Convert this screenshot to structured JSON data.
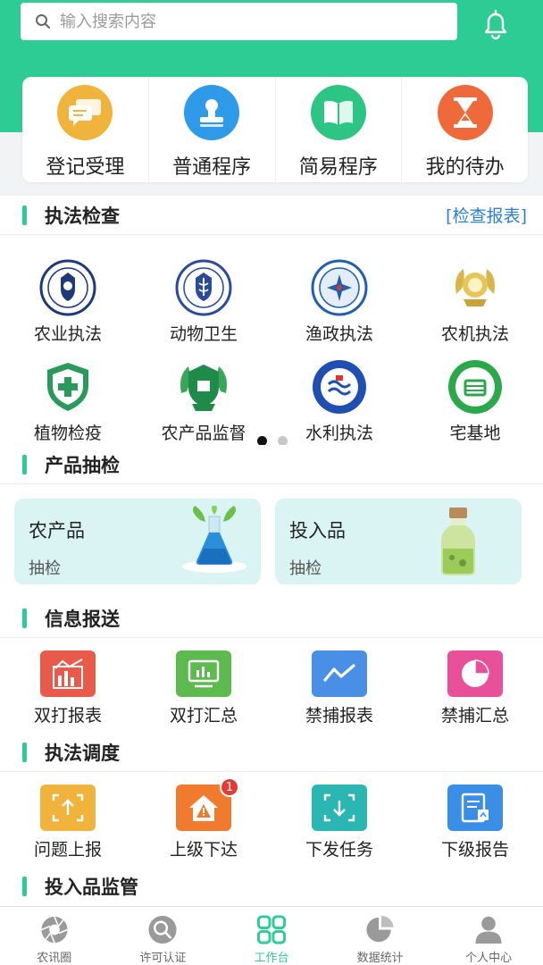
{
  "search": {
    "placeholder": "输入搜索内容"
  },
  "quick_actions": [
    {
      "label": "登记受理",
      "color": "#f0b43c",
      "icon": "message-icon"
    },
    {
      "label": "普通程序",
      "color": "#2f9be8",
      "icon": "stamp-icon"
    },
    {
      "label": "简易程序",
      "color": "#2dc584",
      "icon": "book-icon"
    },
    {
      "label": "我的待办",
      "color": "#ee6a3a",
      "icon": "hourglass-icon"
    }
  ],
  "law_check": {
    "title": "执法检查",
    "link": "[检查报表]",
    "items": [
      {
        "label": "农业执法",
        "icon": "agri-law-badge-icon"
      },
      {
        "label": "动物卫生",
        "icon": "animal-health-badge-icon"
      },
      {
        "label": "渔政执法",
        "icon": "fishery-badge-icon"
      },
      {
        "label": "农机执法",
        "icon": "agri-machinery-badge-icon"
      },
      {
        "label": "植物检疫",
        "icon": "plant-quarantine-badge-icon"
      },
      {
        "label": "农产品监督",
        "icon": "agri-product-badge-icon"
      },
      {
        "label": "水利执法",
        "icon": "water-law-badge-icon"
      },
      {
        "label": "宅基地",
        "icon": "homestead-badge-icon"
      }
    ],
    "pages": 2,
    "current_page": 1
  },
  "sampling": {
    "title": "产品抽检",
    "cards": [
      {
        "title": "农产品",
        "sub": "抽检",
        "icon": "flask-icon"
      },
      {
        "title": "投入品",
        "sub": "抽检",
        "icon": "bottle-icon"
      }
    ]
  },
  "info_report": {
    "title": "信息报送",
    "items": [
      {
        "label": "双打报表",
        "color": "#ea5a4a",
        "icon": "bar-chart-icon"
      },
      {
        "label": "双打汇总",
        "color": "#5cba4e",
        "icon": "monitor-chart-icon"
      },
      {
        "label": "禁捕报表",
        "color": "#4a8fe6",
        "icon": "line-chart-icon"
      },
      {
        "label": "禁捕汇总",
        "color": "#e8509a",
        "icon": "pie-chart-icon"
      }
    ]
  },
  "dispatch": {
    "title": "执法调度",
    "items": [
      {
        "label": "问题上报",
        "color": "#f0b43c",
        "icon": "upload-scan-icon"
      },
      {
        "label": "上级下达",
        "color": "#f07a2e",
        "icon": "house-alert-icon",
        "badge": "1"
      },
      {
        "label": "下发任务",
        "color": "#2ab6b2",
        "icon": "download-scan-icon"
      },
      {
        "label": "下级报告",
        "color": "#3a8ee6",
        "icon": "report-doc-icon"
      }
    ]
  },
  "input_supervision": {
    "title": "投入品监管"
  },
  "tabs": [
    {
      "label": "农讯圈",
      "icon": "aperture-icon",
      "active": false
    },
    {
      "label": "许可认证",
      "icon": "search-circle-icon",
      "active": false
    },
    {
      "label": "工作台",
      "icon": "grid-icon",
      "active": true
    },
    {
      "label": "数据统计",
      "icon": "pie-icon",
      "active": false
    },
    {
      "label": "个人中心",
      "icon": "person-icon",
      "active": false
    }
  ],
  "colors": {
    "brand": "#2dcc94",
    "link": "#2b7fd4",
    "card_bg": "#d9f4f3"
  }
}
